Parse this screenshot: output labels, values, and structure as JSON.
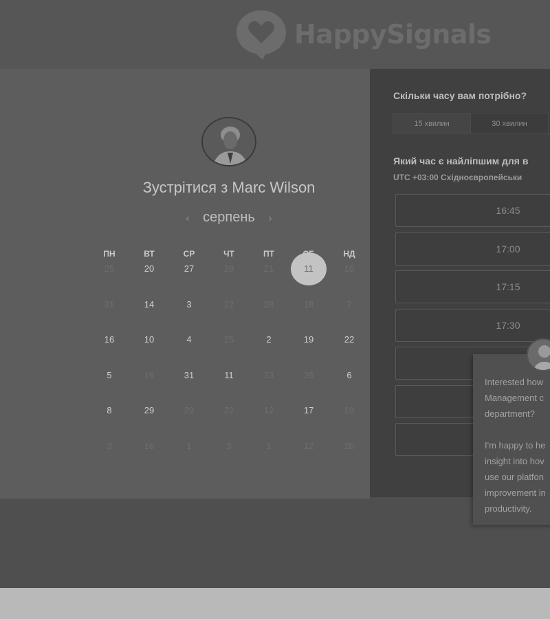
{
  "brand": {
    "name": "HappySignals"
  },
  "calendar": {
    "title": "Зустрітися з Marc Wilson",
    "month": "серпень",
    "prev_arrow": "‹",
    "next_arrow": "›",
    "weekdays": [
      "ПН",
      "ВТ",
      "СР",
      "ЧТ",
      "ПТ",
      "СБ",
      "НД"
    ],
    "weeks": [
      [
        "25",
        "20",
        "27",
        "28",
        "21",
        "11",
        "10"
      ],
      [
        "31",
        "14",
        "3",
        "22",
        "28",
        "18",
        "7"
      ],
      [
        "16",
        "10",
        "4",
        "25",
        "2",
        "19",
        "22"
      ],
      [
        "5",
        "16",
        "31",
        "11",
        "23",
        "26",
        "6"
      ],
      [
        "8",
        "29",
        "29",
        "22",
        "12",
        "17",
        "19"
      ],
      [
        "3",
        "16",
        "1",
        "3",
        "1",
        "12",
        "20"
      ]
    ],
    "selected_day": "11"
  },
  "booking": {
    "duration_question": "Скільки часу вам потрібно?",
    "durations": [
      "15 хвилин",
      "30 хвилин"
    ],
    "time_question": "Який час є найліпшим для в",
    "timezone": "UTC +03:00 Східноєвропейськи",
    "slots": [
      "16:45",
      "17:00",
      "17:15",
      "17:30",
      "",
      "",
      ""
    ]
  },
  "chat": {
    "message": "Interested how\nManagement c\ndepartment?\n\nI'm happy to he\ninsight into hov\nuse our platfon\nimprovement in\nproductivity."
  }
}
